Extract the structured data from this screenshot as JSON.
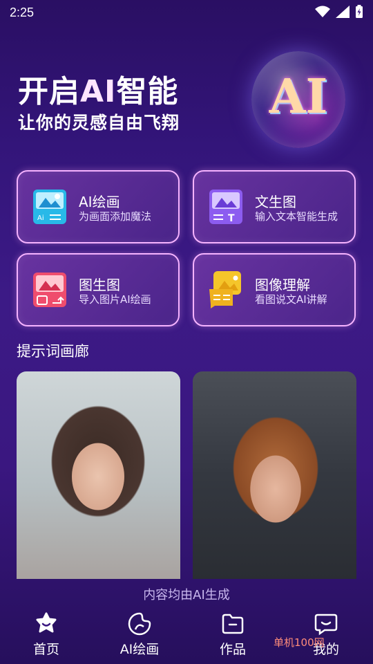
{
  "status": {
    "time": "2:25"
  },
  "hero": {
    "title_pre": "开启",
    "title_ai": "AI",
    "title_post": "智能",
    "subtitle": "让你的灵感自由飞翔",
    "orb_text": "AI"
  },
  "cards": [
    {
      "title": "AI绘画",
      "desc": "为画面添加魔法"
    },
    {
      "title": "文生图",
      "desc": "输入文本智能生成"
    },
    {
      "title": "图生图",
      "desc": "导入图片AI绘画"
    },
    {
      "title": "图像理解",
      "desc": "看图说文AI讲解"
    }
  ],
  "gallery": {
    "title": "提示词画廊"
  },
  "disclaimer": "内容均由AI生成",
  "nav": [
    {
      "label": "首页",
      "icon": "home-icon"
    },
    {
      "label": "AI绘画",
      "icon": "palette-icon"
    },
    {
      "label": "作品",
      "icon": "folder-icon"
    },
    {
      "label": "我的",
      "icon": "chat-icon"
    }
  ],
  "watermark": "单机100网"
}
